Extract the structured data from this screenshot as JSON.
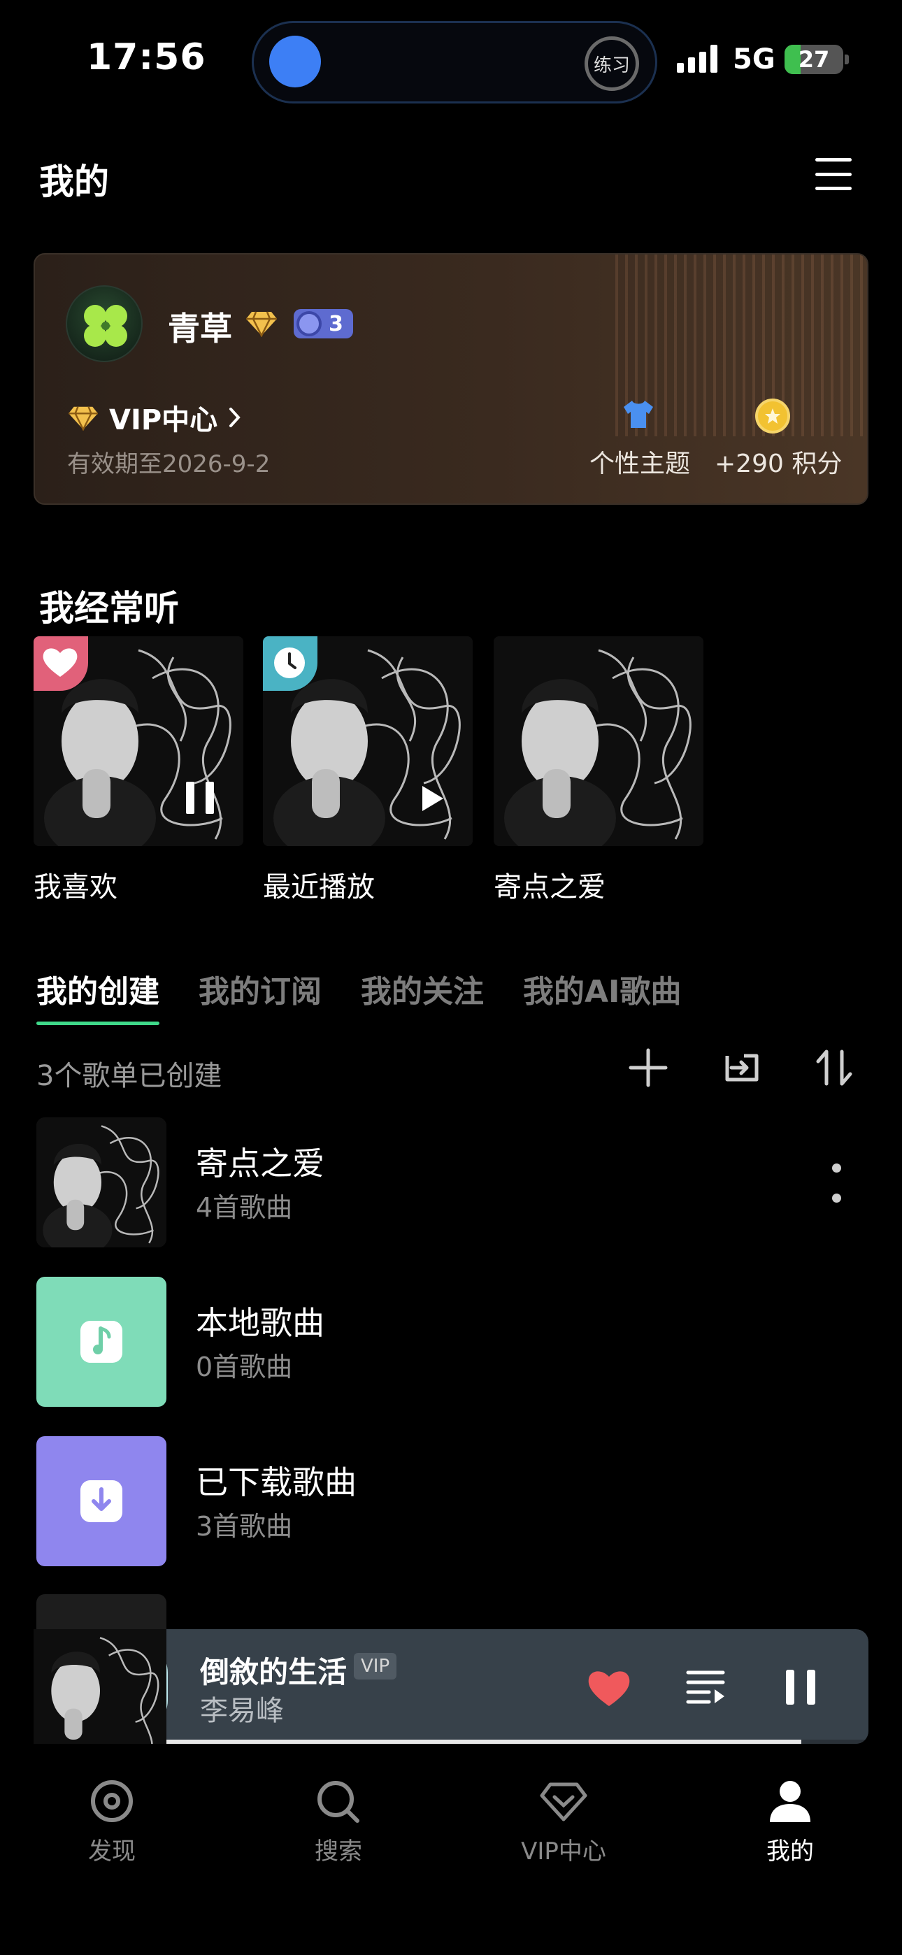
{
  "status_bar": {
    "time": "17:56",
    "island_label": "练习",
    "network": "5G",
    "battery": "27",
    "battery_level_pct": 27
  },
  "header": {
    "title": "我的"
  },
  "profile": {
    "username": "青草",
    "level": "3",
    "vip_center_label": "VIP中心",
    "validity": "有效期至2026-9-2",
    "theme_label": "个性主题",
    "points_label": "+290 积分"
  },
  "frequent": {
    "title": "我经常听",
    "items": [
      {
        "label": "我喜欢",
        "badge": "heart"
      },
      {
        "label": "最近播放",
        "badge": "clock"
      },
      {
        "label": "寄点之爱",
        "badge": ""
      }
    ]
  },
  "tabs": [
    {
      "label": "我的创建",
      "active": true
    },
    {
      "label": "我的订阅",
      "active": false
    },
    {
      "label": "我的关注",
      "active": false
    },
    {
      "label": "我的AI歌曲",
      "active": false
    }
  ],
  "created_count": "3个歌单已创建",
  "playlists": [
    {
      "title": "寄点之爱",
      "subtitle": "4首歌曲",
      "cover": "album-photo"
    },
    {
      "title": "本地歌曲",
      "subtitle": "0首歌曲",
      "cover": "music-note-icon"
    },
    {
      "title": "已下载歌曲",
      "subtitle": "3首歌曲",
      "cover": "download-icon"
    }
  ],
  "player": {
    "song": "倒敘的生活",
    "vip_tag": "VIP",
    "artist": "李易峰",
    "progress": 0.92
  },
  "nav": [
    {
      "label": "发现",
      "icon": "discover-icon"
    },
    {
      "label": "搜索",
      "icon": "search-icon"
    },
    {
      "label": "VIP中心",
      "icon": "vip-diamond-icon"
    },
    {
      "label": "我的",
      "icon": "profile-icon",
      "active": true
    }
  ],
  "colors": {
    "accent": "#3fd98a",
    "heart": "#f0595c",
    "local_cover": "#7fdcb8",
    "download_cover": "#8f86ee",
    "level_badge": "#5e6bd0"
  }
}
